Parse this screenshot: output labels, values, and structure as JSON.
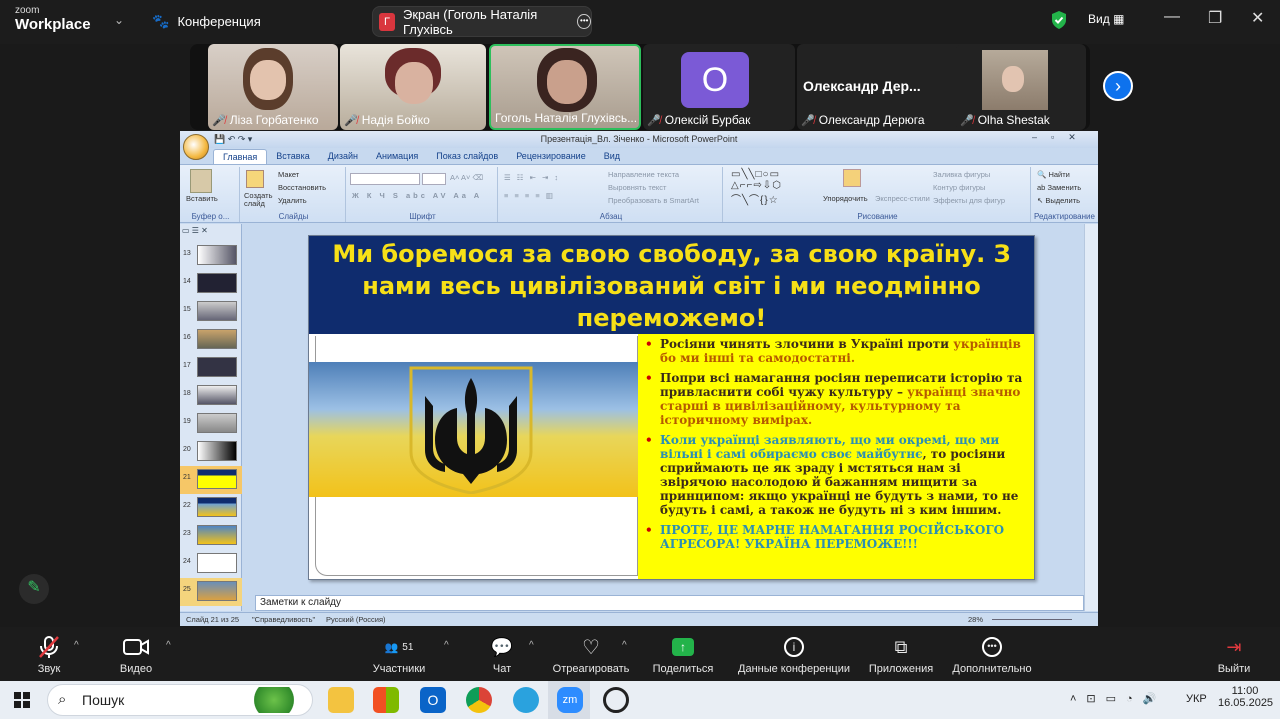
{
  "zoom": {
    "logo_small": "zoom",
    "logo_big": "Workplace",
    "meeting_label": "Конференция",
    "share_title": "Экран (Гоголь Наталія Глухівсь",
    "share_badge": "Г",
    "view_label": "Вид",
    "participants": [
      {
        "name": "Ліза Горбатенко",
        "muted": true
      },
      {
        "name": "Надія Бойко",
        "muted": true
      },
      {
        "name": "Гоголь Наталія Глухівсь...",
        "muted": false
      },
      {
        "name": "Олексій Бурбак",
        "muted": true,
        "avatar_letter": "O"
      },
      {
        "name": "Олександр Дерюга",
        "muted": true,
        "header": "Олександр  Дер..."
      },
      {
        "name": "Olha Shestak",
        "muted": true
      }
    ],
    "toolbar": {
      "audio": "Звук",
      "video": "Видео",
      "participants": "Участники",
      "participants_count": "51",
      "chat": "Чат",
      "react": "Отреагировать",
      "share": "Поделиться",
      "info": "Данные конференции",
      "apps": "Приложения",
      "more": "Дополнительно",
      "leave": "Выйти"
    }
  },
  "ppt": {
    "title": "Презентація_Вл. Зіченко - Microsoft PowerPoint",
    "tabs": [
      "Главная",
      "Вставка",
      "Дизайн",
      "Анимация",
      "Показ слайдов",
      "Рецензирование",
      "Вид"
    ],
    "ribbon": {
      "paste": "Вставить",
      "clipboard": "Буфер о...",
      "create_slide": "Создать слайд",
      "layout": "Макет",
      "restore": "Восстановить",
      "delete": "Удалить",
      "slides_group": "Слайды",
      "font_group": "Шрифт",
      "text_direction": "Направление текста",
      "align_text": "Выровнять текст",
      "smartart": "Преобразовать в SmartArt",
      "paragraph_group": "Абзац",
      "arrange": "Упорядочить",
      "quick_styles": "Экспресс-стили",
      "fill": "Заливка фигуры",
      "outline": "Контур фигуры",
      "effects": "Эффекты для фигур",
      "drawing_group": "Рисование",
      "find": "Найти",
      "replace": "Заменить",
      "select": "Выделить",
      "editing_group": "Редактирование"
    },
    "thumb_numbers": [
      "13",
      "14",
      "15",
      "16",
      "17",
      "18",
      "19",
      "20",
      "21",
      "22",
      "23",
      "24",
      "25"
    ],
    "selected_thumb": "21",
    "slide": {
      "heading": "Ми боремося за свою свободу, за свою країну. З нами весь цивілізований світ і ми неодмінно переможемо!",
      "b1_a": "Росіяни чинять злочини в Україні проти ",
      "b1_b": "українців бо ми інші та самодостатні.",
      "b2_a": "Попри всі намагання росіян переписати історію та привласнити собі чужу культуру – ",
      "b2_b": "українці значно старші в цивілізаційному, культурному та історичному вимірах.",
      "b3_a": "Коли українці заявляють, що ми окремі, що ми вільні і самі обираємо своє майбутнє",
      "b3_b": ", то росіяни сприймають це як зраду і мстяться нам зі звірячою насолодою й бажанням нищити за принципом: якщо українці не будуть з нами, то не будуть і самі, а також не будуть ні з ким іншим.",
      "b4": "ПРОТЕ, ЦЕ МАРНЕ НАМАГАННЯ РОСІЙСЬКОГО АГРЕСОРА! УКРАЇНА ПЕРЕМОЖЕ!!!"
    },
    "notes": "Заметки к слайду",
    "status": {
      "slide": "Слайд 21 из 25",
      "theme": "\"Справедливость\"",
      "lang": "Русский (Россия)",
      "zoom": "28%"
    }
  },
  "taskbar": {
    "search": "Пошук",
    "lang": "УКР",
    "time": "11:00",
    "date": "16.05.2025"
  }
}
